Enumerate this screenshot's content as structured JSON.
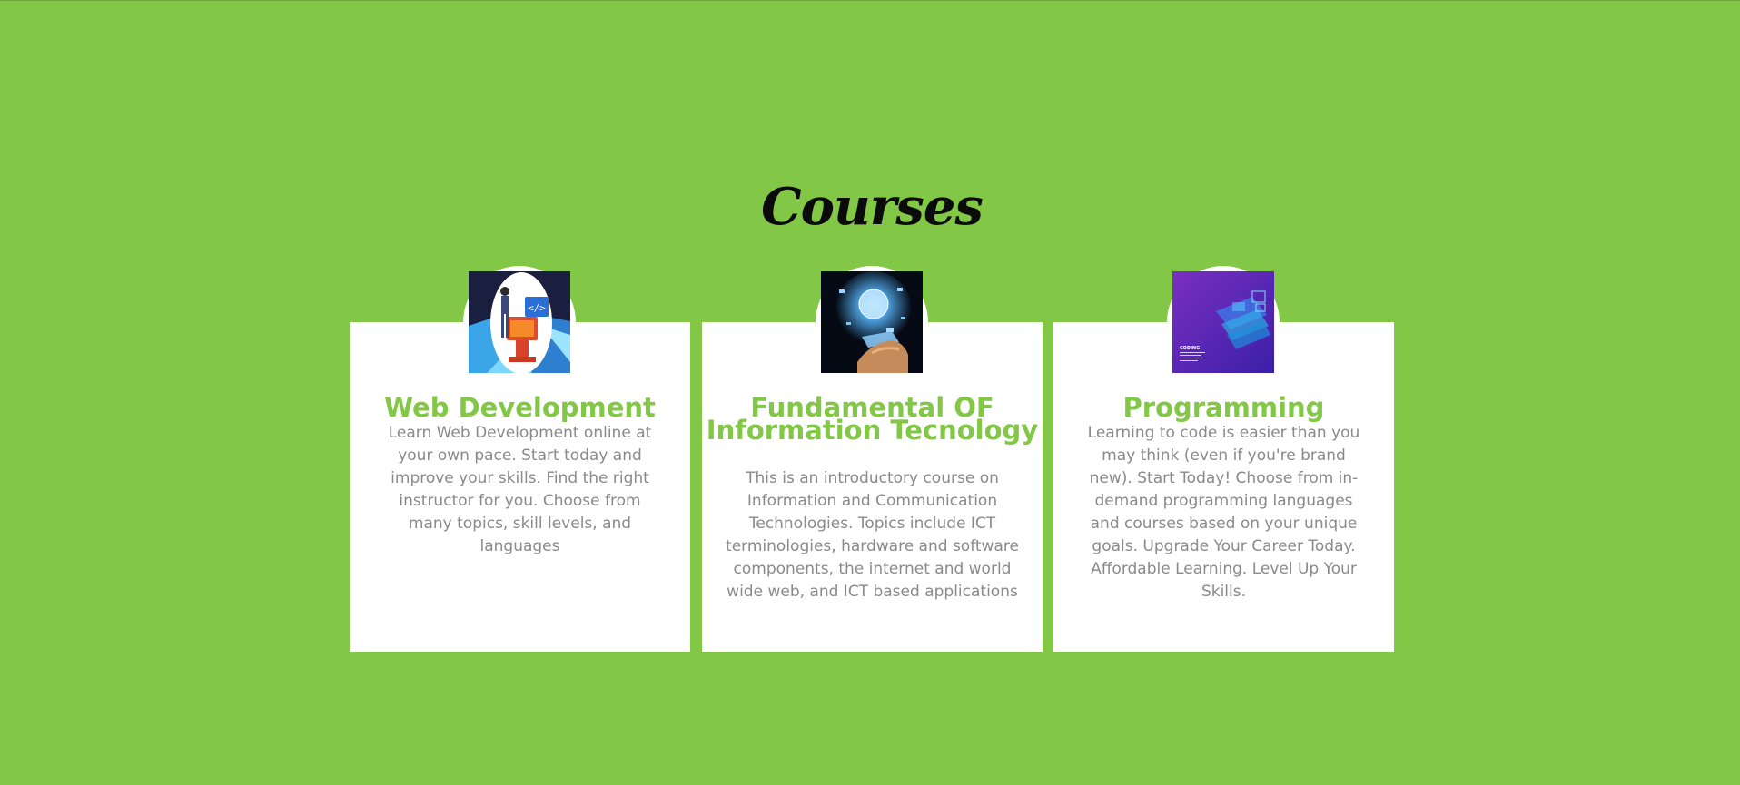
{
  "section": {
    "title": "Courses"
  },
  "courses": [
    {
      "title": "Web Development",
      "description": "Learn Web Development online at your own pace. Start today and improve your skills. Find the right instructor for you. Choose from many topics, skill levels, and languages",
      "image_icon": "web-development-illustration"
    },
    {
      "title": "Fundamental OF Information Tecnology",
      "description": "This is an introductory course on Information and Communication Technologies. Topics include ICT terminologies, hardware and software components, the internet and world wide web, and ICT based applications",
      "image_icon": "information-technology-illustration"
    },
    {
      "title": "Programming",
      "description": "Learning to code is easier than you may think (even if you're brand new). Start Today! Choose from in-demand programming languages and courses based on your unique goals. Upgrade Your Career Today. Affordable Learning. Level Up Your Skills.",
      "image_icon": "programming-illustration",
      "image_caption": "CODING"
    }
  ],
  "colors": {
    "background": "#82c846",
    "accent": "#82c846",
    "card": "#ffffff",
    "body_text": "#8a8a8a",
    "heading_text": "#0b0b0b"
  }
}
